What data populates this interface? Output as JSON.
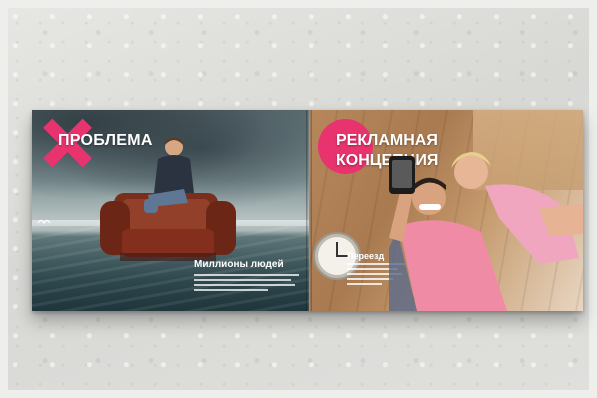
{
  "left_page": {
    "headline": "ПРОБЛЕМА",
    "caption_title": "Миллионы людей"
  },
  "right_page": {
    "headline_line1": "РЕКЛАМНАЯ",
    "headline_line2": "КОНЦЕПЦИЯ",
    "caption_title": "Переезд"
  },
  "colors": {
    "accent_pink": "#e8336e"
  }
}
